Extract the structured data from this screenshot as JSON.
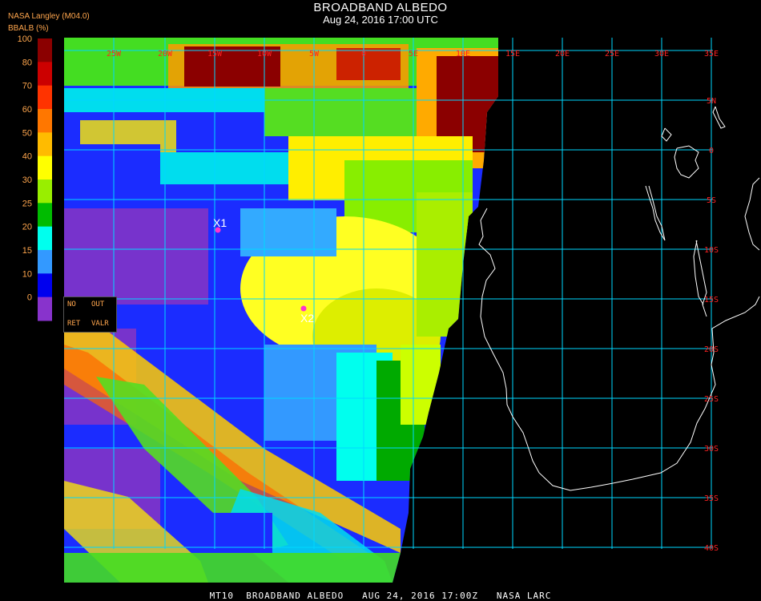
{
  "header": {
    "title": "BROADBAND ALBEDO",
    "subtitle": "Aug 24, 2016 17:00 UTC",
    "organization": "NASA Langley (M04.0)",
    "parameter_label": "BBALB (%)"
  },
  "colorbar": {
    "ticks": [
      "100",
      "80",
      "70",
      "60",
      "50",
      "40",
      "30",
      "25",
      "20",
      "15",
      "10",
      "0"
    ],
    "colors": [
      "#8b0000",
      "#cc0000",
      "#ff3300",
      "#ff7700",
      "#ffbb00",
      "#ffff00",
      "#99ee00",
      "#00bb00",
      "#00ffee",
      "#3399ff",
      "#0000ee",
      "#8833cc"
    ]
  },
  "flags": {
    "no": "NO",
    "out": "OUT",
    "ret": "RET",
    "valr": "VALR"
  },
  "grid": {
    "lon_labels": [
      "25W",
      "20W",
      "15W",
      "10W",
      "5W",
      "0",
      "5E",
      "10E",
      "15E",
      "20E",
      "25E",
      "30E",
      "35E"
    ],
    "lat_labels": [
      "5N",
      "0",
      "5S",
      "10S",
      "15S",
      "20S",
      "25S",
      "30S",
      "35S",
      "40S"
    ],
    "grid_color": "#00d8ff",
    "label_color": "#ff2222"
  },
  "markers": {
    "x1": "X1",
    "x2": "X2",
    "marker_color": "#ff33cc"
  },
  "footer": {
    "text": "MT10  BROADBAND ALBEDO   AUG 24, 2016 17:00Z   NASA LARC"
  }
}
